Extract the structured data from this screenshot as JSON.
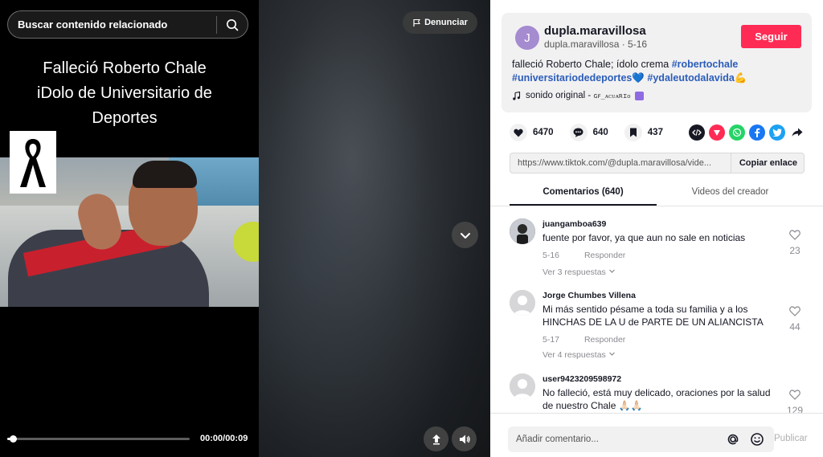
{
  "video": {
    "search_placeholder": "Buscar contenido relacionado",
    "title_line1": "Falleció Roberto Chale",
    "title_line2": "iDolo de Universitario de",
    "title_line3": "Deportes",
    "report_label": "Denunciar",
    "time": "00:00/00:09",
    "progress": 0.03
  },
  "creator": {
    "avatar_letter": "J",
    "name": "dupla.maravillosa",
    "handle_date": "dupla.maravillosa · 5-16",
    "follow_label": "Seguir",
    "caption_text": "falleció Roberto Chale; ídolo crema ",
    "tag1": "#robertochale",
    "tag2": "#universitariodedeportes💙",
    "tag3": "#ydaleutodalavida💪",
    "sound_label": "sonido original - ",
    "sound_author": "ɢꜰ_ᴀᴄᴜᴀʀɪᴏ"
  },
  "stats": {
    "likes": "6470",
    "comments": "640",
    "saves": "437"
  },
  "share": {
    "url": "https://www.tiktok.com/@dupla.maravillosa/vide...",
    "copy_label": "Copiar enlace"
  },
  "tabs": {
    "comments": "Comentarios (640)",
    "creator_videos": "Videos del creador"
  },
  "comments": [
    {
      "user": "juangamboa639",
      "text": "fuente por favor, ya que aun no sale en noticias",
      "date": "5-16",
      "reply": "Responder",
      "likes": "23",
      "more": "Ver 3 respuestas"
    },
    {
      "user": "Jorge Chumbes Villena",
      "text": "Mi más sentido pésame a toda su familia y a los HINCHAS DE LA U de PARTE DE UN ALIANCISTA",
      "date": "5-17",
      "reply": "Responder",
      "likes": "44",
      "more": "Ver 4 respuestas"
    },
    {
      "user": "user9423209598972",
      "text": "No falleció, está muy delicado, oraciones por la salud de nuestro Chale 🙏🏻🙏🏻",
      "likes": "129"
    }
  ],
  "comment_bar": {
    "placeholder": "Añadir comentario...",
    "post_label": "Publicar"
  },
  "colors": {
    "accent": "#fe2c55",
    "hashtag": "#2b5db9"
  }
}
